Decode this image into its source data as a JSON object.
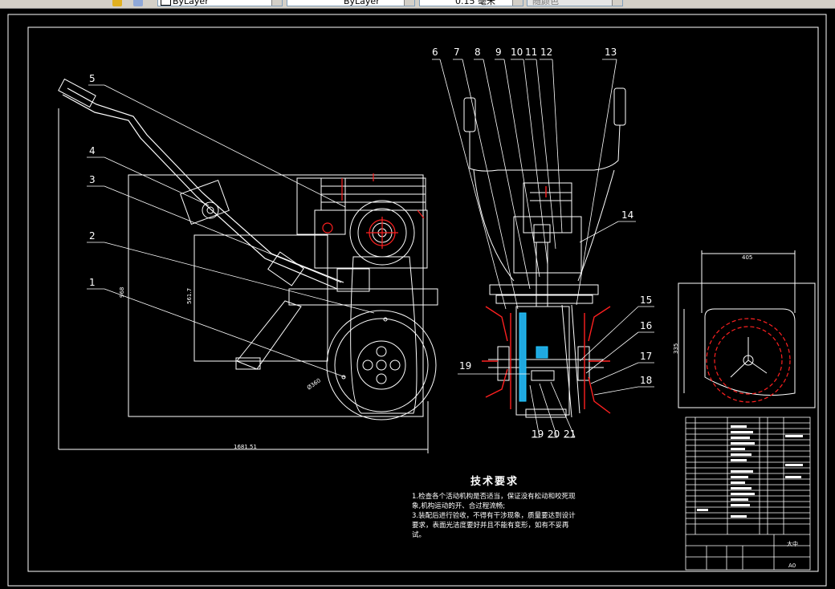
{
  "toolbar": {
    "layer_combo": "ByLayer",
    "linetype_combo": "ByLayer",
    "lineweight_combo": "0.15 毫米",
    "plotstyle_combo": "随颜色"
  },
  "drawing": {
    "part_numbers_left": [
      "5",
      "4",
      "3",
      "2",
      "1"
    ],
    "part_numbers_top": [
      "6",
      "7",
      "8",
      "9",
      "10",
      "11",
      "12",
      "13"
    ],
    "part_numbers_right": [
      "14",
      "15",
      "16",
      "17",
      "18"
    ],
    "part_numbers_bottom": [
      "19",
      "19",
      "20",
      "21"
    ],
    "dim_width": "1681.51",
    "dim_height_outer": "968",
    "dim_height_inner": "561.7",
    "dim_wheel": "Ø360",
    "dim_side_width": "405",
    "dim_side_height": "335",
    "tech_requirements": {
      "title": "技术要求",
      "lines": [
        "1.检查各个活动机构是否适当，保证没有松动和咬死现",
        "象,机构运动的开、合过程流畅;",
        "3.装配后进行验收，不得有干涉现象，质量要达到设计",
        "要求，表面光洁度要好并且不能有变形，如有不妥再",
        "试。"
      ]
    },
    "title_block": {
      "scale": "A0",
      "name": "大中"
    }
  }
}
